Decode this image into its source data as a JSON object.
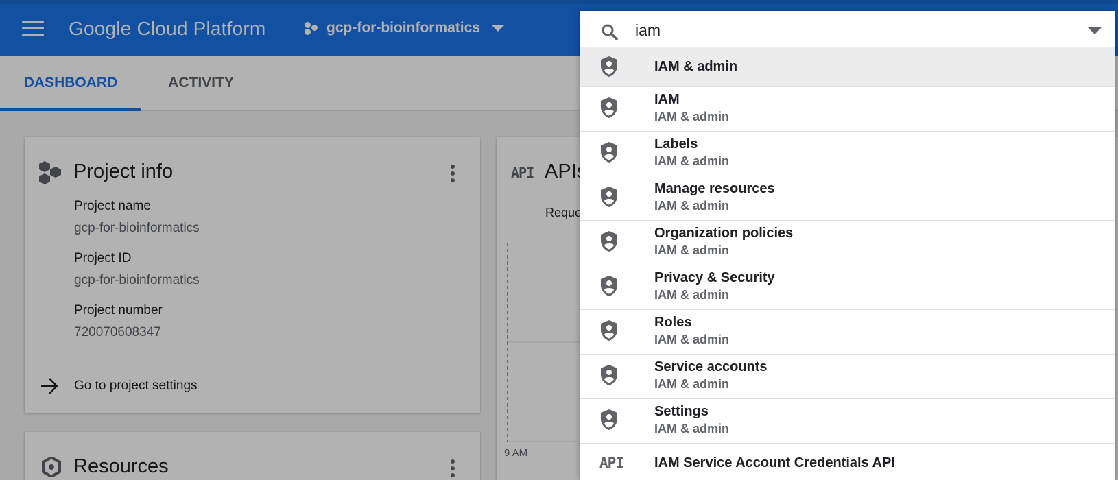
{
  "header": {
    "app_title": "Google Cloud Platform",
    "project_name": "gcp-for-bioinformatics",
    "menu_icon": "hamburger-menu-icon",
    "project_icon": "project-dots-icon",
    "colors": {
      "bar": "#1a73e8",
      "accent": "#1a73e8"
    }
  },
  "tabs": [
    {
      "label": "DASHBOARD",
      "active": true
    },
    {
      "label": "ACTIVITY",
      "active": false
    }
  ],
  "project_info": {
    "title": "Project info",
    "icon": "project-hexagons-icon",
    "fields": [
      {
        "label": "Project name",
        "value": "gcp-for-bioinformatics"
      },
      {
        "label": "Project ID",
        "value": "gcp-for-bioinformatics"
      },
      {
        "label": "Project number",
        "value": "720070608347"
      }
    ],
    "link_label": "Go to project settings",
    "link_icon": "arrow-right-icon"
  },
  "resources": {
    "title": "Resources",
    "icon": "resources-hexagon-icon"
  },
  "apis": {
    "badge": "API",
    "title_partial": "APIs",
    "subtitle_partial": "Reque",
    "x_tick": "9 AM"
  },
  "search": {
    "value": "iam",
    "icon": "search-icon"
  },
  "results": [
    {
      "title": "IAM & admin",
      "subtitle": "",
      "icon": "shield-icon",
      "highlight": true
    },
    {
      "title": "IAM",
      "subtitle": "IAM & admin",
      "icon": "shield-icon"
    },
    {
      "title": "Labels",
      "subtitle": "IAM & admin",
      "icon": "shield-icon"
    },
    {
      "title": "Manage resources",
      "subtitle": "IAM & admin",
      "icon": "shield-icon"
    },
    {
      "title": "Organization policies",
      "subtitle": "IAM & admin",
      "icon": "shield-icon"
    },
    {
      "title": "Privacy & Security",
      "subtitle": "IAM & admin",
      "icon": "shield-icon"
    },
    {
      "title": "Roles",
      "subtitle": "IAM & admin",
      "icon": "shield-icon"
    },
    {
      "title": "Service accounts",
      "subtitle": "IAM & admin",
      "icon": "shield-icon"
    },
    {
      "title": "Settings",
      "subtitle": "IAM & admin",
      "icon": "shield-icon"
    },
    {
      "title": "IAM Service Account Credentials API",
      "subtitle": "",
      "icon": "api-icon",
      "badge": "API"
    }
  ]
}
